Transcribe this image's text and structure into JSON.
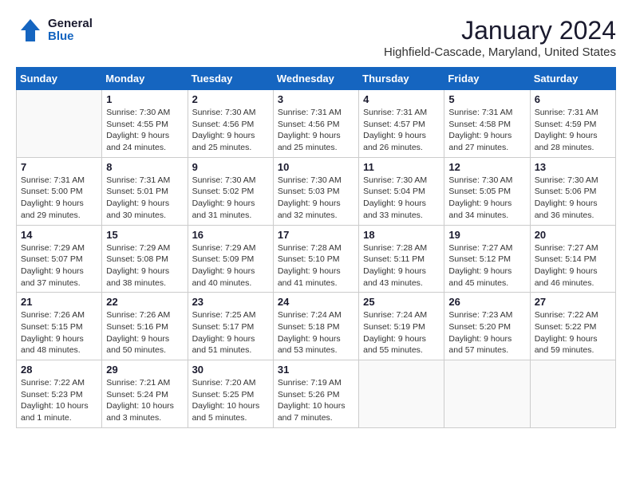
{
  "header": {
    "logo_general": "General",
    "logo_blue": "Blue",
    "month_title": "January 2024",
    "location": "Highfield-Cascade, Maryland, United States"
  },
  "calendar": {
    "days_of_week": [
      "Sunday",
      "Monday",
      "Tuesday",
      "Wednesday",
      "Thursday",
      "Friday",
      "Saturday"
    ],
    "weeks": [
      [
        {
          "day": "",
          "info": ""
        },
        {
          "day": "1",
          "info": "Sunrise: 7:30 AM\nSunset: 4:55 PM\nDaylight: 9 hours\nand 24 minutes."
        },
        {
          "day": "2",
          "info": "Sunrise: 7:30 AM\nSunset: 4:56 PM\nDaylight: 9 hours\nand 25 minutes."
        },
        {
          "day": "3",
          "info": "Sunrise: 7:31 AM\nSunset: 4:56 PM\nDaylight: 9 hours\nand 25 minutes."
        },
        {
          "day": "4",
          "info": "Sunrise: 7:31 AM\nSunset: 4:57 PM\nDaylight: 9 hours\nand 26 minutes."
        },
        {
          "day": "5",
          "info": "Sunrise: 7:31 AM\nSunset: 4:58 PM\nDaylight: 9 hours\nand 27 minutes."
        },
        {
          "day": "6",
          "info": "Sunrise: 7:31 AM\nSunset: 4:59 PM\nDaylight: 9 hours\nand 28 minutes."
        }
      ],
      [
        {
          "day": "7",
          "info": "Sunrise: 7:31 AM\nSunset: 5:00 PM\nDaylight: 9 hours\nand 29 minutes."
        },
        {
          "day": "8",
          "info": "Sunrise: 7:31 AM\nSunset: 5:01 PM\nDaylight: 9 hours\nand 30 minutes."
        },
        {
          "day": "9",
          "info": "Sunrise: 7:30 AM\nSunset: 5:02 PM\nDaylight: 9 hours\nand 31 minutes."
        },
        {
          "day": "10",
          "info": "Sunrise: 7:30 AM\nSunset: 5:03 PM\nDaylight: 9 hours\nand 32 minutes."
        },
        {
          "day": "11",
          "info": "Sunrise: 7:30 AM\nSunset: 5:04 PM\nDaylight: 9 hours\nand 33 minutes."
        },
        {
          "day": "12",
          "info": "Sunrise: 7:30 AM\nSunset: 5:05 PM\nDaylight: 9 hours\nand 34 minutes."
        },
        {
          "day": "13",
          "info": "Sunrise: 7:30 AM\nSunset: 5:06 PM\nDaylight: 9 hours\nand 36 minutes."
        }
      ],
      [
        {
          "day": "14",
          "info": "Sunrise: 7:29 AM\nSunset: 5:07 PM\nDaylight: 9 hours\nand 37 minutes."
        },
        {
          "day": "15",
          "info": "Sunrise: 7:29 AM\nSunset: 5:08 PM\nDaylight: 9 hours\nand 38 minutes."
        },
        {
          "day": "16",
          "info": "Sunrise: 7:29 AM\nSunset: 5:09 PM\nDaylight: 9 hours\nand 40 minutes."
        },
        {
          "day": "17",
          "info": "Sunrise: 7:28 AM\nSunset: 5:10 PM\nDaylight: 9 hours\nand 41 minutes."
        },
        {
          "day": "18",
          "info": "Sunrise: 7:28 AM\nSunset: 5:11 PM\nDaylight: 9 hours\nand 43 minutes."
        },
        {
          "day": "19",
          "info": "Sunrise: 7:27 AM\nSunset: 5:12 PM\nDaylight: 9 hours\nand 45 minutes."
        },
        {
          "day": "20",
          "info": "Sunrise: 7:27 AM\nSunset: 5:14 PM\nDaylight: 9 hours\nand 46 minutes."
        }
      ],
      [
        {
          "day": "21",
          "info": "Sunrise: 7:26 AM\nSunset: 5:15 PM\nDaylight: 9 hours\nand 48 minutes."
        },
        {
          "day": "22",
          "info": "Sunrise: 7:26 AM\nSunset: 5:16 PM\nDaylight: 9 hours\nand 50 minutes."
        },
        {
          "day": "23",
          "info": "Sunrise: 7:25 AM\nSunset: 5:17 PM\nDaylight: 9 hours\nand 51 minutes."
        },
        {
          "day": "24",
          "info": "Sunrise: 7:24 AM\nSunset: 5:18 PM\nDaylight: 9 hours\nand 53 minutes."
        },
        {
          "day": "25",
          "info": "Sunrise: 7:24 AM\nSunset: 5:19 PM\nDaylight: 9 hours\nand 55 minutes."
        },
        {
          "day": "26",
          "info": "Sunrise: 7:23 AM\nSunset: 5:20 PM\nDaylight: 9 hours\nand 57 minutes."
        },
        {
          "day": "27",
          "info": "Sunrise: 7:22 AM\nSunset: 5:22 PM\nDaylight: 9 hours\nand 59 minutes."
        }
      ],
      [
        {
          "day": "28",
          "info": "Sunrise: 7:22 AM\nSunset: 5:23 PM\nDaylight: 10 hours\nand 1 minute."
        },
        {
          "day": "29",
          "info": "Sunrise: 7:21 AM\nSunset: 5:24 PM\nDaylight: 10 hours\nand 3 minutes."
        },
        {
          "day": "30",
          "info": "Sunrise: 7:20 AM\nSunset: 5:25 PM\nDaylight: 10 hours\nand 5 minutes."
        },
        {
          "day": "31",
          "info": "Sunrise: 7:19 AM\nSunset: 5:26 PM\nDaylight: 10 hours\nand 7 minutes."
        },
        {
          "day": "",
          "info": ""
        },
        {
          "day": "",
          "info": ""
        },
        {
          "day": "",
          "info": ""
        }
      ]
    ]
  }
}
